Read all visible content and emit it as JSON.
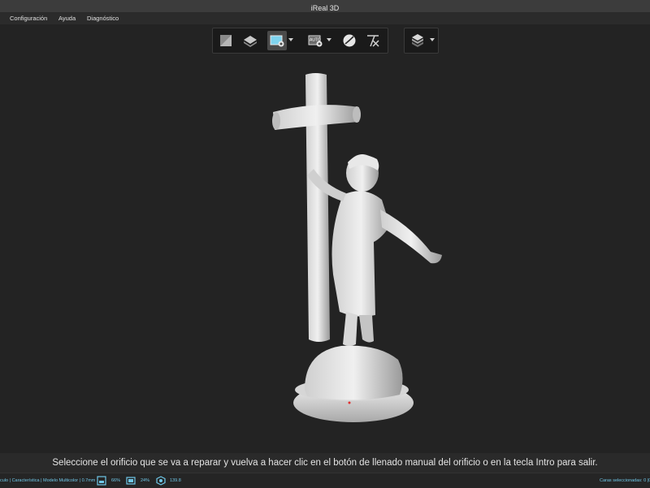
{
  "window": {
    "title": "iReal 3D"
  },
  "menu": {
    "items": [
      {
        "label": "Configuración"
      },
      {
        "label": "Ayuda"
      },
      {
        "label": "Diagnóstico"
      }
    ]
  },
  "toolbar": {
    "auto_label": "AUTO"
  },
  "instruction": {
    "text": "Seleccione el orificio que se va a reparar y vuelva a hacer clic en el botón de llenado manual del orificio o en la tecla Intro para salir."
  },
  "status": {
    "mode_text": "culo | Característica | Modelo Multicolor | 0.7mm",
    "memory_value": "66%",
    "gpu_value": "24%",
    "speed_value": "139.8",
    "selected_text": "Caras seleccionadas: 0 |0"
  },
  "colors": {
    "accent": "#6fc7e8",
    "background": "#232323",
    "panel": "#2a2a2a"
  }
}
